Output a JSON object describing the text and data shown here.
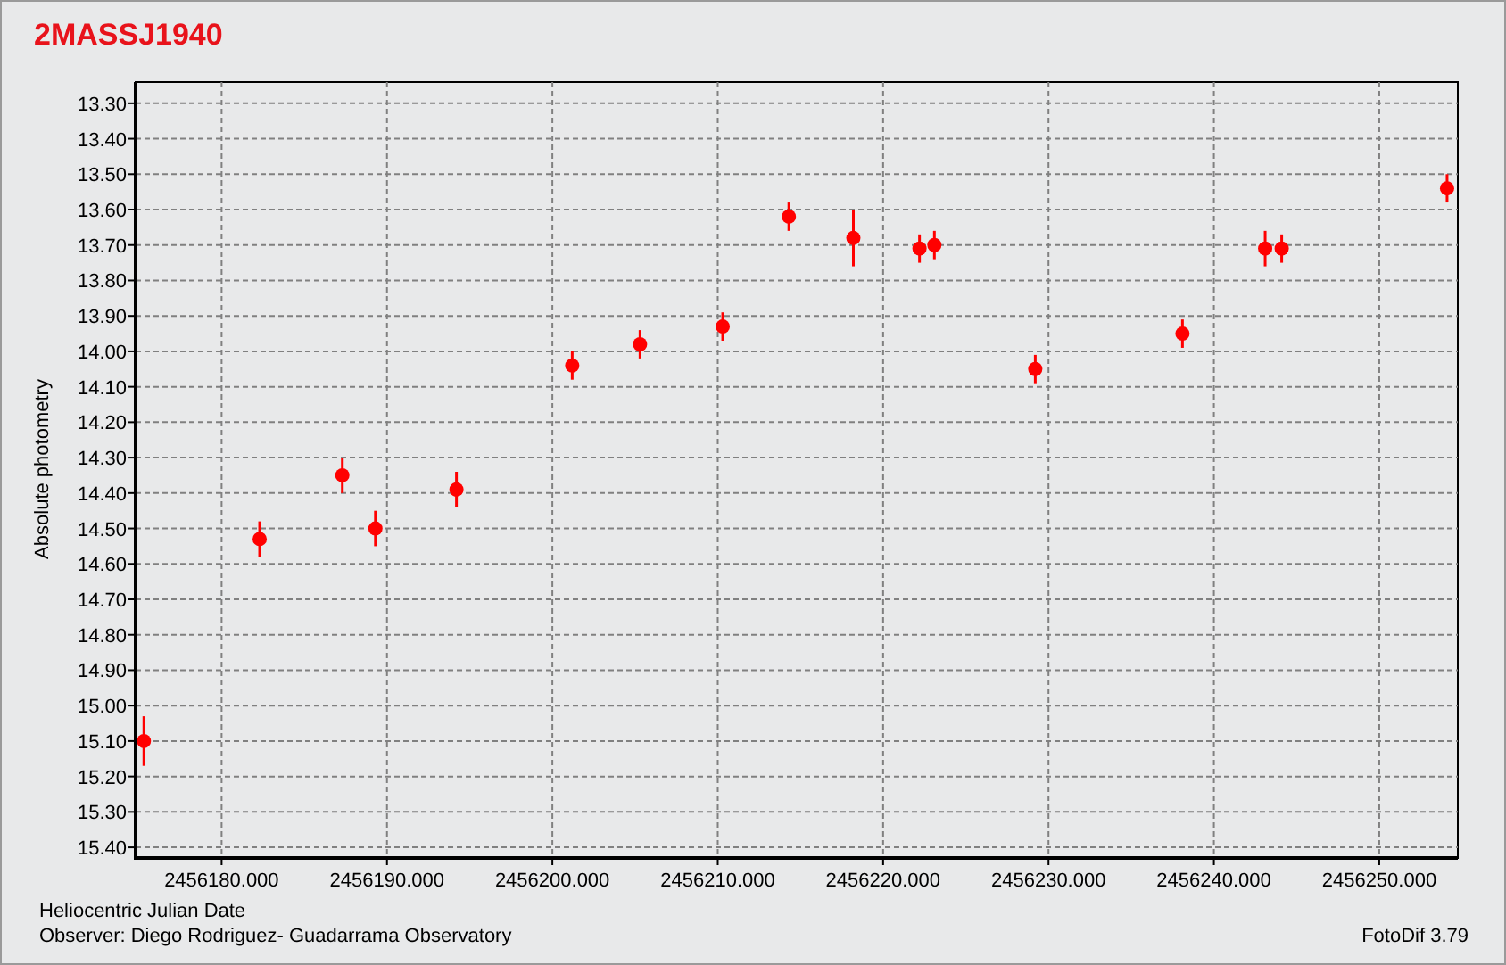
{
  "title": "2MASSJ1940",
  "chart": {
    "chart_data": {
      "type": "scatter",
      "ylabel": "Absolute photometry",
      "xlabel": "Heliocentric Julian Date",
      "xlim": [
        2456174.8,
        2456254.75
      ],
      "ylim": [
        15.43,
        13.24
      ],
      "grid": true,
      "xticks": [
        {
          "value": 2456180,
          "label": "2456180.000"
        },
        {
          "value": 2456190,
          "label": "2456190.000"
        },
        {
          "value": 2456200,
          "label": "2456200.000"
        },
        {
          "value": 2456210,
          "label": "2456210.000"
        },
        {
          "value": 2456220,
          "label": "2456220.000"
        },
        {
          "value": 2456230,
          "label": "2456230.000"
        },
        {
          "value": 2456240,
          "label": "2456240.000"
        },
        {
          "value": 2456250,
          "label": "2456250.000"
        }
      ],
      "yticks": [
        {
          "value": 13.3,
          "label": "13.30"
        },
        {
          "value": 13.4,
          "label": "13.40"
        },
        {
          "value": 13.5,
          "label": "13.50"
        },
        {
          "value": 13.6,
          "label": "13.60"
        },
        {
          "value": 13.7,
          "label": "13.70"
        },
        {
          "value": 13.8,
          "label": "13.80"
        },
        {
          "value": 13.9,
          "label": "13.90"
        },
        {
          "value": 14.0,
          "label": "14.00"
        },
        {
          "value": 14.1,
          "label": "14.10"
        },
        {
          "value": 14.2,
          "label": "14.20"
        },
        {
          "value": 14.3,
          "label": "14.30"
        },
        {
          "value": 14.4,
          "label": "14.40"
        },
        {
          "value": 14.5,
          "label": "14.50"
        },
        {
          "value": 14.6,
          "label": "14.60"
        },
        {
          "value": 14.7,
          "label": "14.70"
        },
        {
          "value": 14.8,
          "label": "14.80"
        },
        {
          "value": 14.9,
          "label": "14.90"
        },
        {
          "value": 15.0,
          "label": "15.00"
        },
        {
          "value": 15.1,
          "label": "15.10"
        },
        {
          "value": 15.2,
          "label": "15.20"
        },
        {
          "value": 15.3,
          "label": "15.30"
        },
        {
          "value": 15.4,
          "label": "15.40"
        }
      ],
      "x": [
        2456175.3,
        2456182.3,
        2456187.3,
        2456189.3,
        2456194.2,
        2456201.2,
        2456205.3,
        2456210.3,
        2456214.3,
        2456218.2,
        2456222.2,
        2456223.1,
        2456229.2,
        2456238.1,
        2456243.1,
        2456244.1,
        2456254.1
      ],
      "series": [
        {
          "color": "#ff0000",
          "values": [
            15.1,
            14.53,
            14.35,
            14.5,
            14.39,
            14.04,
            13.98,
            13.93,
            13.62,
            13.68,
            13.71,
            13.7,
            14.05,
            13.95,
            13.71,
            13.71,
            13.54
          ],
          "errors": [
            0.07,
            0.05,
            0.05,
            0.05,
            0.05,
            0.04,
            0.04,
            0.04,
            0.04,
            0.08,
            0.04,
            0.04,
            0.04,
            0.04,
            0.05,
            0.04,
            0.04
          ]
        }
      ]
    }
  },
  "observer": "Observer: Diego Rodriguez- Guadarrama Observatory",
  "software": "FotoDif 3.79"
}
